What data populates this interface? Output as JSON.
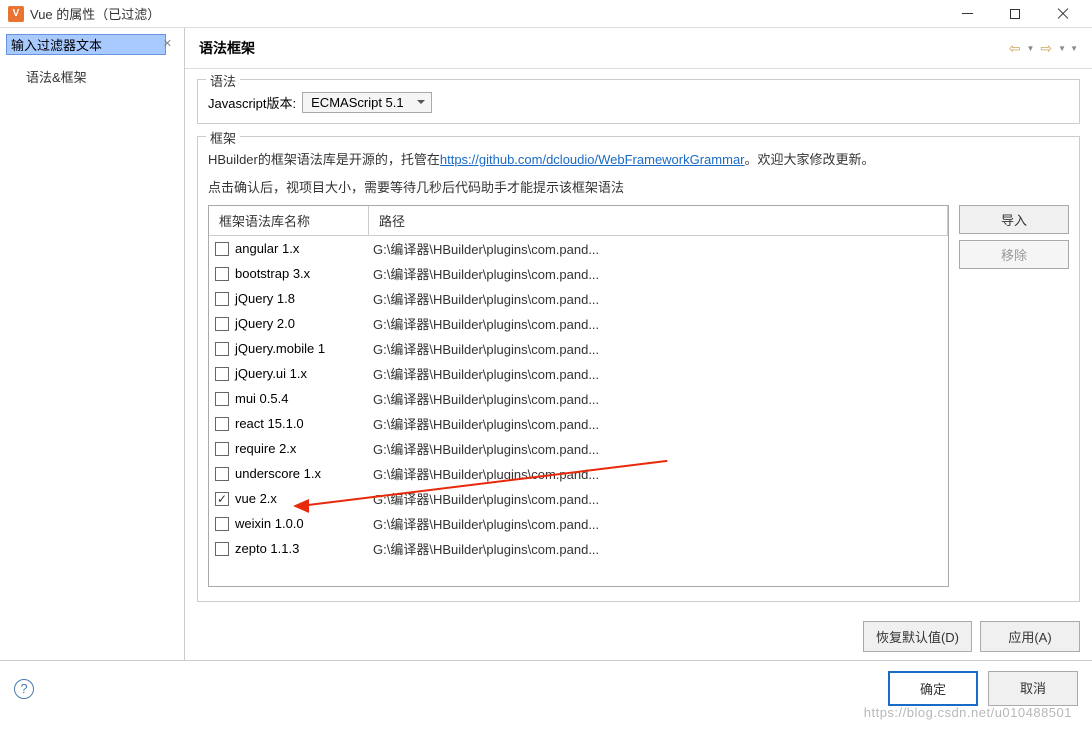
{
  "titlebar": {
    "icon_letter": "V",
    "title": "Vue 的属性（已过滤）"
  },
  "sidebar": {
    "filter_placeholder": "输入过滤器文本",
    "filter_value": "输入过滤器文本",
    "items": [
      "语法&框架"
    ]
  },
  "content": {
    "title": "语法框架"
  },
  "grammar": {
    "legend": "语法",
    "js_version_label": "Javascript版本:",
    "js_version_value": "ECMAScript 5.1"
  },
  "framework": {
    "legend": "框架",
    "desc_prefix": "HBuilder的框架语法库是开源的，托管在",
    "desc_link": "https://github.com/dcloudio/WebFrameworkGrammar",
    "desc_suffix": "。欢迎大家修改更新。",
    "desc_line2": "点击确认后，视项目大小，需要等待几秒后代码助手才能提示该框架语法",
    "columns": {
      "name": "框架语法库名称",
      "path": "路径"
    },
    "rows": [
      {
        "checked": false,
        "name": "angular 1.x",
        "path": "G:\\编译器\\HBuilder\\plugins\\com.pand..."
      },
      {
        "checked": false,
        "name": "bootstrap 3.x",
        "path": "G:\\编译器\\HBuilder\\plugins\\com.pand..."
      },
      {
        "checked": false,
        "name": "jQuery 1.8",
        "path": "G:\\编译器\\HBuilder\\plugins\\com.pand..."
      },
      {
        "checked": false,
        "name": "jQuery 2.0",
        "path": "G:\\编译器\\HBuilder\\plugins\\com.pand..."
      },
      {
        "checked": false,
        "name": "jQuery.mobile 1",
        "path": "G:\\编译器\\HBuilder\\plugins\\com.pand..."
      },
      {
        "checked": false,
        "name": "jQuery.ui 1.x",
        "path": "G:\\编译器\\HBuilder\\plugins\\com.pand..."
      },
      {
        "checked": false,
        "name": "mui 0.5.4",
        "path": "G:\\编译器\\HBuilder\\plugins\\com.pand..."
      },
      {
        "checked": false,
        "name": "react 15.1.0",
        "path": "G:\\编译器\\HBuilder\\plugins\\com.pand..."
      },
      {
        "checked": false,
        "name": "require 2.x",
        "path": "G:\\编译器\\HBuilder\\plugins\\com.pand..."
      },
      {
        "checked": false,
        "name": "underscore 1.x",
        "path": "G:\\编译器\\HBuilder\\plugins\\com.pand..."
      },
      {
        "checked": true,
        "name": "vue 2.x",
        "path": "G:\\编译器\\HBuilder\\plugins\\com.pand..."
      },
      {
        "checked": false,
        "name": "weixin 1.0.0",
        "path": "G:\\编译器\\HBuilder\\plugins\\com.pand..."
      },
      {
        "checked": false,
        "name": "zepto 1.1.3",
        "path": "G:\\编译器\\HBuilder\\plugins\\com.pand..."
      }
    ],
    "buttons": {
      "import": "导入",
      "remove": "移除"
    }
  },
  "bottom": {
    "restore": "恢复默认值(D)",
    "apply": "应用(A)"
  },
  "footer": {
    "ok": "确定",
    "cancel": "取消"
  },
  "watermark": "https://blog.csdn.net/u010488501"
}
